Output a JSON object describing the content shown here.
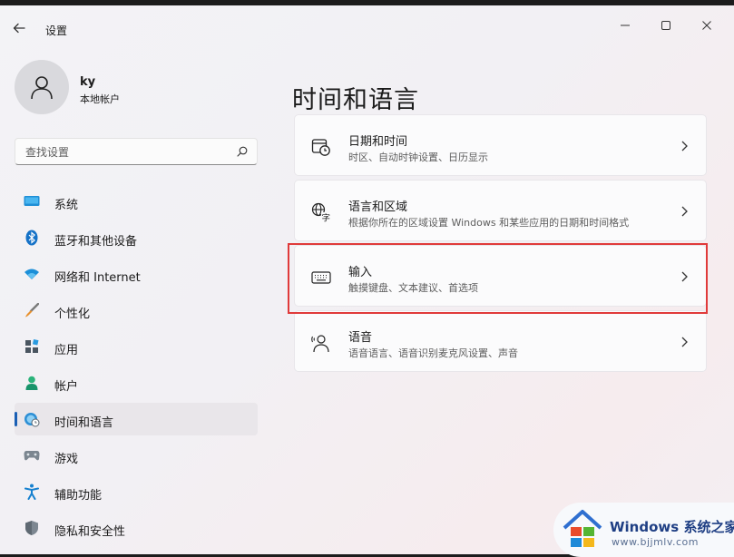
{
  "window": {
    "title": "设置"
  },
  "user": {
    "name": "ky",
    "account_type": "本地帐户"
  },
  "search": {
    "placeholder": "查找设置"
  },
  "sidebar": {
    "items": [
      {
        "label": "系统",
        "icon": "system-icon",
        "active": false
      },
      {
        "label": "蓝牙和其他设备",
        "icon": "bluetooth-icon",
        "active": false
      },
      {
        "label": "网络和 Internet",
        "icon": "wifi-icon",
        "active": false
      },
      {
        "label": "个性化",
        "icon": "brush-icon",
        "active": false
      },
      {
        "label": "应用",
        "icon": "apps-icon",
        "active": false
      },
      {
        "label": "帐户",
        "icon": "person-icon",
        "active": false
      },
      {
        "label": "时间和语言",
        "icon": "globe-clock-icon",
        "active": true
      },
      {
        "label": "游戏",
        "icon": "gamepad-icon",
        "active": false
      },
      {
        "label": "辅助功能",
        "icon": "accessibility-icon",
        "active": false
      },
      {
        "label": "隐私和安全性",
        "icon": "shield-icon",
        "active": false
      }
    ]
  },
  "main": {
    "title": "时间和语言",
    "cards": [
      {
        "title": "日期和时间",
        "subtitle": "时区、自动时钟设置、日历显示",
        "icon": "calendar-clock-icon"
      },
      {
        "title": "语言和区域",
        "subtitle": "根据你所在的区域设置 Windows 和某些应用的日期和时间格式",
        "icon": "language-icon"
      },
      {
        "title": "输入",
        "subtitle": "触摸键盘、文本建议、首选项",
        "icon": "keyboard-icon"
      },
      {
        "title": "语音",
        "subtitle": "语音语言、语音识别麦克风设置、声音",
        "icon": "speech-icon"
      }
    ]
  },
  "watermark": {
    "brand": "Windows",
    "brand_suffix": "系统之家",
    "url": "www.bjjmlv.com"
  },
  "colors": {
    "accent": "#1a5fb4",
    "highlight_border": "#e03a3a"
  }
}
